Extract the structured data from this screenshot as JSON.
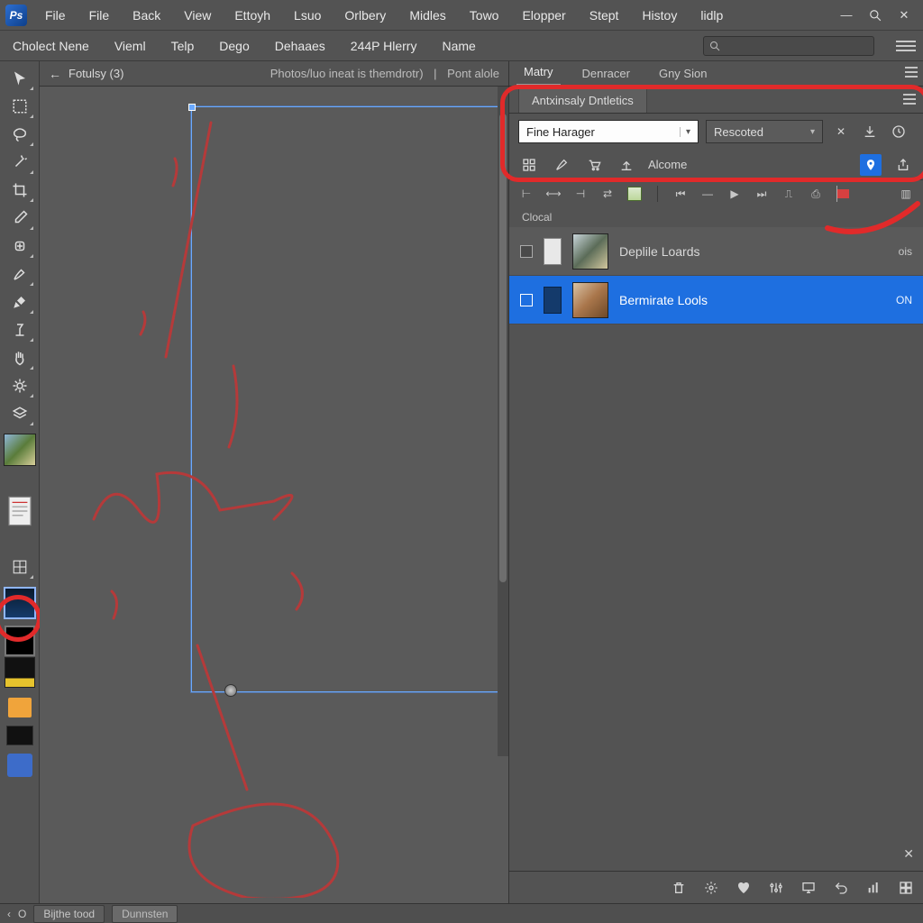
{
  "menubar": {
    "items": [
      "File",
      "File",
      "Back",
      "View",
      "Ettoyh",
      "Lsuo",
      "Orlbery",
      "Midles",
      "Towo",
      "Elopper",
      "Stept",
      "Histoy",
      "lidlp"
    ]
  },
  "optionsbar": {
    "items": [
      "Cholect Nene",
      "Vieml",
      "Telp",
      "Dego",
      "Dehaaes",
      "244P Hlerry",
      "Name"
    ],
    "search_placeholder": ""
  },
  "document": {
    "back_label": "←",
    "title": "Fotulsy (3)",
    "meta_left": "Photos/luo ineat is themdrotr)",
    "meta_right": "Pont alole"
  },
  "panel_tabs_top": {
    "items": [
      "Matry",
      "Denracer",
      "Gny Sion"
    ],
    "active": 0
  },
  "panel_subtab": "Antxinsaly Dntletics",
  "picker": {
    "combo1": "Fine Harager",
    "combo2": "Rescoted"
  },
  "toolrow_label": "Alcome",
  "list_header": "Clocal",
  "rows": [
    {
      "name": "Deplile Loards",
      "status": "ois",
      "selected": false
    },
    {
      "name": "Bermirate Lools",
      "status": "ON",
      "selected": true
    }
  ],
  "statusbar": {
    "left_arrow": "‹",
    "o": "O",
    "pill1": "Bijthe tood",
    "pill2": "Dunnsten"
  },
  "icons": {
    "close": "✕",
    "search": "⌕",
    "minimize": "—",
    "grid": "▦",
    "brush": "✎",
    "cart": "🛒",
    "upload": "⬆",
    "pin": "📍",
    "export": "⤴",
    "info": "ⓘ",
    "gear": "⚙",
    "heart": "♥",
    "refresh": "↻",
    "sliders": "⚙"
  },
  "colors": {
    "annotation": "#e12a2a",
    "selection": "#1e6fe0",
    "artboard_border": "#6aa9ff"
  }
}
